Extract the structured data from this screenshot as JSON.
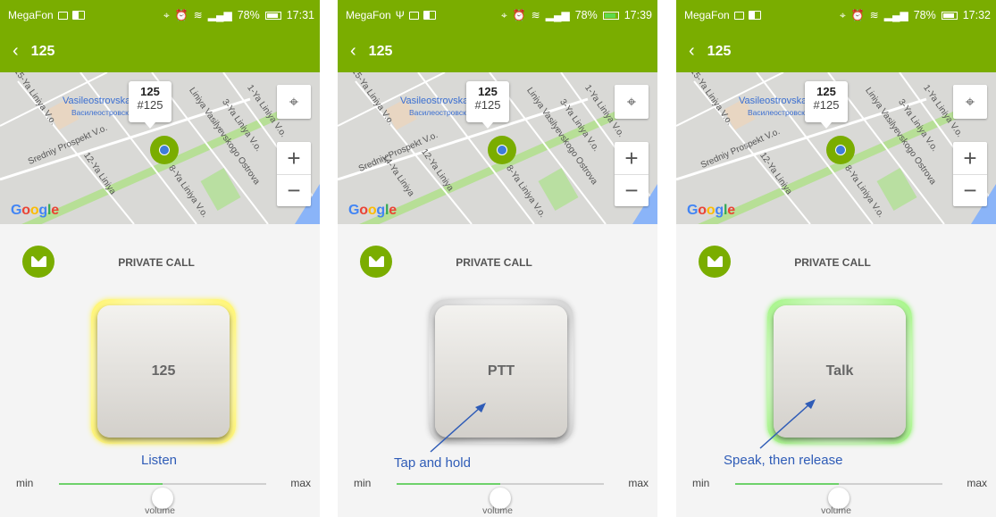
{
  "colors": {
    "app_green": "#7aad00",
    "hint_blue": "#2f5cb7",
    "volume_fill": "#6ed16a"
  },
  "screens": [
    {
      "status": {
        "carrier": "MegaFon",
        "battery": "78%",
        "time": "17:31",
        "charging": false
      },
      "appbar": {
        "back_icon": "chevron-left-icon",
        "title": "125"
      },
      "map": {
        "callout_title": "125",
        "callout_sub": "#125",
        "labels": [
          "15-Ya Liniya V.o.",
          "Vasileostrovskaya",
          "Василеостровская",
          "Sredniy Prospekt V.o.",
          "12-Ya Liniya",
          "1-Ya Liniya V.o.",
          "3-Ya Liniya V.o.",
          "8-Ya Liniya V.o.",
          "Liniya Vasilyevskogo Ostrova"
        ],
        "zoom_in": "+",
        "zoom_out": "−",
        "logo": "Google"
      },
      "call": {
        "title": "PRIVATE CALL",
        "button_label": "125",
        "state": "listen"
      },
      "hint": "Listen",
      "volume": {
        "min": "min",
        "max": "max",
        "label": "volume",
        "level": 0.5
      }
    },
    {
      "status": {
        "carrier": "MegaFon",
        "battery": "78%",
        "time": "17:39",
        "charging": true
      },
      "appbar": {
        "back_icon": "chevron-left-icon",
        "title": "125"
      },
      "map": {
        "callout_title": "125",
        "callout_sub": "#125",
        "labels": [
          "15-Ya Liniya V.o.",
          "Vasileostrovskaya",
          "Василеостровская",
          "Sredniy Prospekt V.o.",
          "14-Ya Liniya",
          "12-Ya Liniya",
          "1-Ya Liniya V.o.",
          "3-Ya Liniya V.o.",
          "8-Ya Liniya V.o.",
          "Liniya Vasilyevskogo Ostrova"
        ],
        "zoom_in": "+",
        "zoom_out": "−",
        "logo": "Google"
      },
      "call": {
        "title": "PRIVATE CALL",
        "button_label": "PTT",
        "state": "idle"
      },
      "hint": "Tap and hold",
      "volume": {
        "min": "min",
        "max": "max",
        "label": "volume",
        "level": 0.5
      }
    },
    {
      "status": {
        "carrier": "MegaFon",
        "battery": "78%",
        "time": "17:32",
        "charging": false
      },
      "appbar": {
        "back_icon": "chevron-left-icon",
        "title": "125"
      },
      "map": {
        "callout_title": "125",
        "callout_sub": "#125",
        "labels": [
          "15-Ya Liniya V.o.",
          "Vasileostrovskaya",
          "Василеостровская",
          "Sredniy Prospekt V.o.",
          "12-Ya Liniya",
          "1-Ya Liniya V.o.",
          "3-Ya Liniya V.o.",
          "8-Ya Liniya V.o.",
          "Liniya Vasilyevskogo Ostrova"
        ],
        "zoom_in": "+",
        "zoom_out": "−",
        "logo": "Google"
      },
      "call": {
        "title": "PRIVATE CALL",
        "button_label": "Talk",
        "state": "talk"
      },
      "hint": "Speak, then release",
      "volume": {
        "min": "min",
        "max": "max",
        "label": "volume",
        "level": 0.5
      }
    }
  ]
}
